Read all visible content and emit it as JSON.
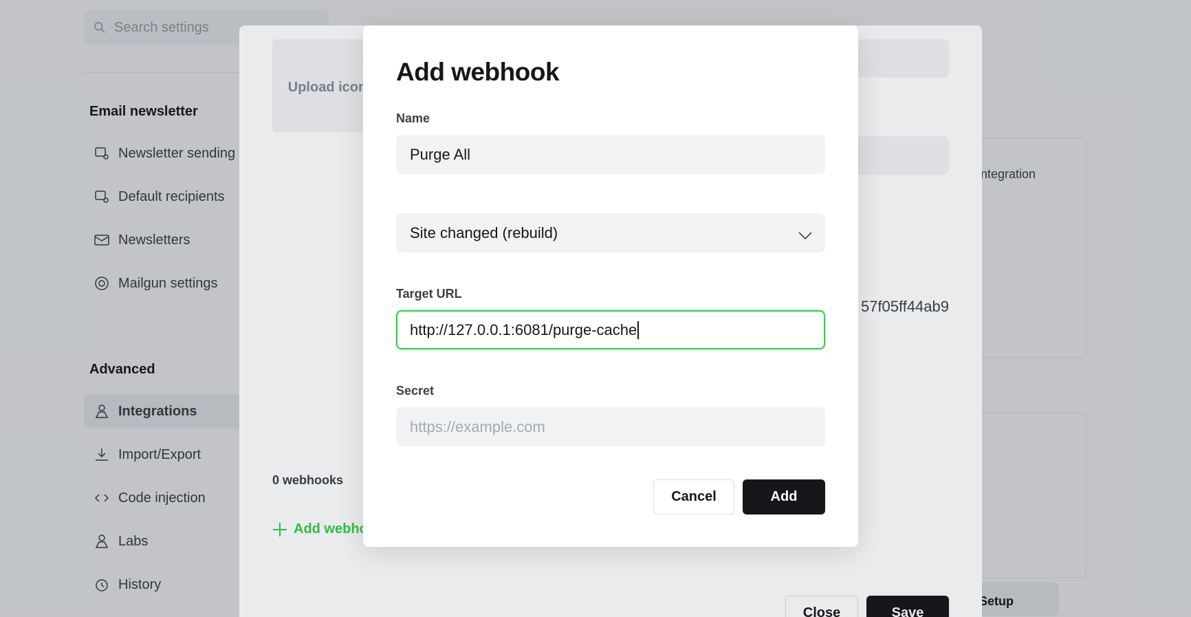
{
  "settings": {
    "search": {
      "placeholder": "Search settings"
    },
    "sidebar": {
      "groups": [
        {
          "title": "Email newsletter",
          "items": [
            {
              "label": "Newsletter sending",
              "icon": "newsletter-sending-icon"
            },
            {
              "label": "Default recipients",
              "icon": "recipients-icon"
            },
            {
              "label": "Newsletters",
              "icon": "mail-icon"
            },
            {
              "label": "Mailgun settings",
              "icon": "mailgun-icon"
            }
          ]
        },
        {
          "title": "Advanced",
          "items": [
            {
              "label": "Integrations",
              "icon": "integrations-icon",
              "active": true
            },
            {
              "label": "Import/Export",
              "icon": "import-export-icon"
            },
            {
              "label": "Code injection",
              "icon": "code-icon"
            },
            {
              "label": "Labs",
              "icon": "labs-icon"
            },
            {
              "label": "History",
              "icon": "history-icon"
            }
          ]
        }
      ]
    },
    "right_panel_text": "Integration",
    "right_pill_text": "Setup"
  },
  "integration": {
    "upload_icon_label": "Upload icon",
    "api_key_tail": "57f05ff44ab9",
    "webhooks_count": "0 webhooks",
    "add_webhook_label": "Add webhook",
    "close_label": "Close",
    "save_label": "Save"
  },
  "dialog": {
    "title": "Add webhook",
    "name_label": "Name",
    "name_value": "Purge All",
    "event_value": "Site changed (rebuild)",
    "target_url_label": "Target URL",
    "target_url_value": "http://127.0.0.1:6081/purge-cache",
    "secret_label": "Secret",
    "secret_placeholder": "https://example.com",
    "cancel_label": "Cancel",
    "add_label": "Add"
  },
  "colors": {
    "accent_green": "#30cf43",
    "primary_dark": "#15171a",
    "field_bg": "#f1f2f4"
  }
}
